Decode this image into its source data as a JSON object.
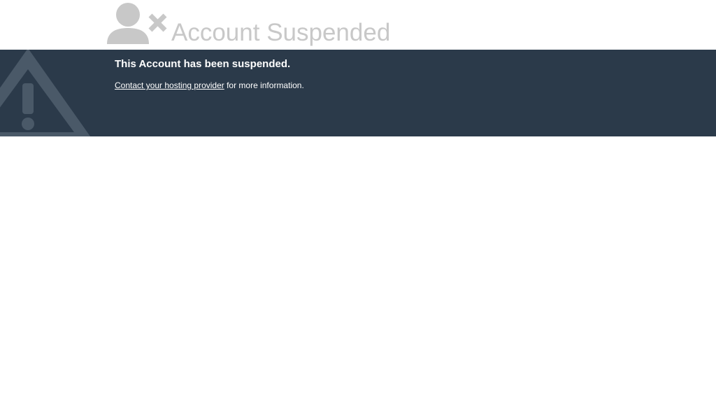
{
  "header": {
    "title": "Account Suspended",
    "icon": "user-remove-icon",
    "title_color": "#c8c8c8"
  },
  "banner": {
    "heading": "This Account has been suspended.",
    "link_text": "Contact your hosting provider",
    "suffix_text": " for more information.",
    "icon": "warning-icon",
    "background_color": "#2b3a4a"
  }
}
